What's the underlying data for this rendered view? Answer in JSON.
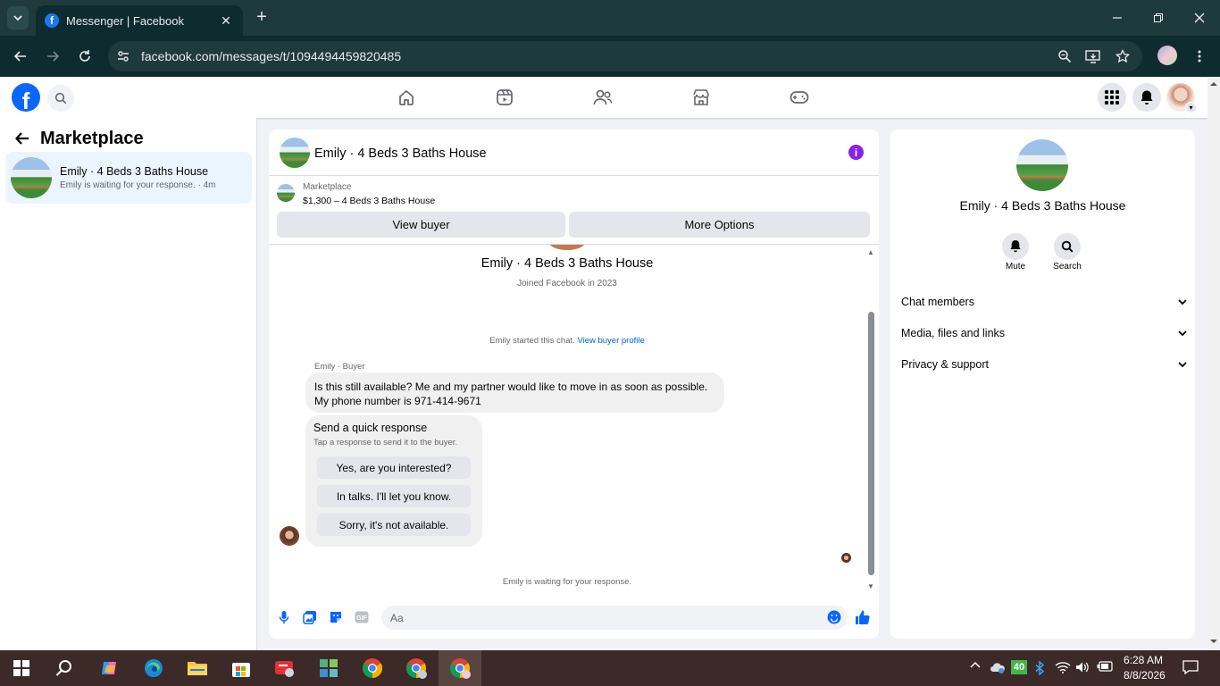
{
  "browser": {
    "tab_title": "Messenger | Facebook",
    "url": "facebook.com/messages/t/1094494459820485",
    "tab_favicon_letter": "f"
  },
  "fb_header": {
    "logo_letter": "f",
    "nav_icons": [
      "home-icon",
      "reels-icon",
      "friends-icon",
      "marketplace-icon",
      "gaming-icon"
    ]
  },
  "sidebar": {
    "title": "Marketplace",
    "conversation": {
      "name": "Emily · 4 Beds 3 Baths House",
      "subtitle": "Emily is waiting for your response. · 4m"
    }
  },
  "chat": {
    "title": "Emily · 4 Beds 3 Baths House",
    "marketplace_label": "Marketplace",
    "listing": "$1,300 – 4 Beds 3 Baths House",
    "view_buyer_button": "View buyer",
    "more_options_button": "More Options",
    "profile_name": "Emily · 4 Beds 3 Baths House",
    "joined": "Joined Facebook in 2023",
    "started_text": "Emily started this chat.",
    "view_buyer_profile_link": "View buyer profile",
    "sender_label": "Emily · Buyer",
    "message_line1": "Is this still available? Me and my partner would like to move in as soon as possible.",
    "message_line2": "My phone number is 971-414-9671",
    "quick_title": "Send a quick response",
    "quick_subtitle": "Tap a response to send it to the buyer.",
    "quick_responses": [
      "Yes, are you interested?",
      "In talks. I'll let you know.",
      "Sorry, it's not available."
    ],
    "waiting": "Emily is waiting for your response.",
    "input_placeholder": "Aa"
  },
  "right_panel": {
    "name": "Emily · 4 Beds 3 Baths House",
    "mute_label": "Mute",
    "search_label": "Search",
    "sections": [
      "Chat members",
      "Media, files and links",
      "Privacy & support"
    ]
  },
  "taskbar": {
    "time": "6:28 AM",
    "date": "8/8/2026",
    "badge": "40"
  },
  "colors": {
    "facebook_blue": "#0866ff",
    "selected_conversation": "#ebf5ff",
    "info_purple": "#8a22e6",
    "link_blue": "#0064d1"
  }
}
